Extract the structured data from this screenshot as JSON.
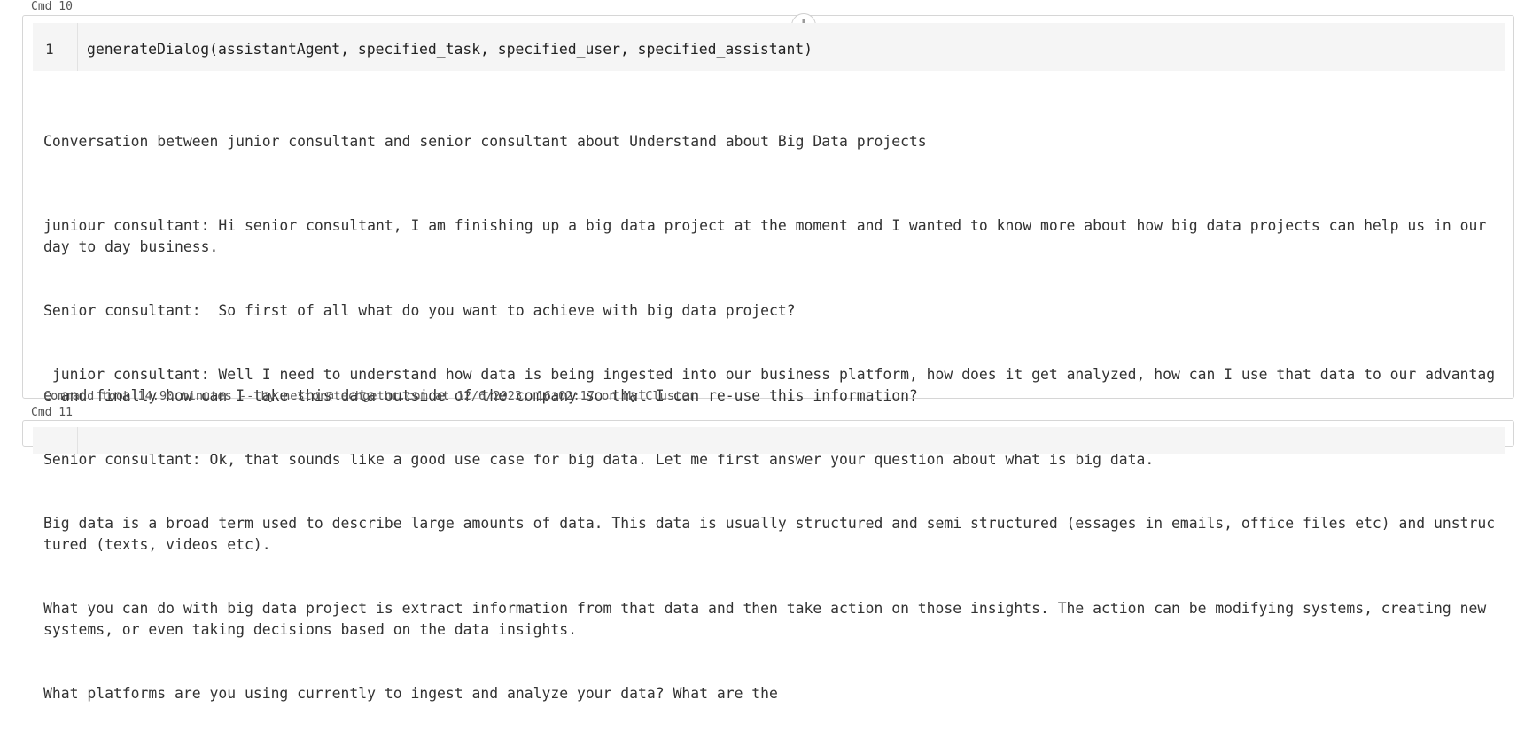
{
  "cells": [
    {
      "label": "Cmd 10",
      "code_line_number": "1",
      "code": "generateDialog(assistantAgent, specified_task, specified_user, specified_assistant)",
      "output": {
        "heading": "Conversation between junior consultant and senior consultant about Understand about Big Data projects",
        "lines": [
          "juniour consultant: Hi senior consultant, I am finishing up a big data project at the moment and I wanted to know more about how big data projects can help us in our day to day business.",
          "Senior consultant:  So first of all what do you want to achieve with big data project?",
          " junior consultant: Well I need to understand how data is being ingested into our business platform, how does it get analyzed, how can I use that data to our advantage and finally how can I take this data outside of the company so that I can re-use this information?",
          "Senior consultant: Ok, that sounds like a good use case for big data. Let me first answer your question about what is big data.",
          "Big data is a broad term used to describe large amounts of data. This data is usually structured and semi structured (essages in emails, office files etc) and unstructured (texts, videos etc).",
          "What you can do with big data project is extract information from that data and then take action on those insights. The action can be modifying systems, creating new systems, or even taking decisions based on the data insights.",
          "What platforms are you using currently to ingest and analyze your data? What are the"
        ]
      },
      "footer": "Command took 14.90 minutes -- by nestor@techgethr.com at 12/6/2023, 16:02:17 on My Cluster"
    },
    {
      "label": "Cmd 11"
    }
  ],
  "icons": {
    "add_cell": "plus-icon"
  }
}
